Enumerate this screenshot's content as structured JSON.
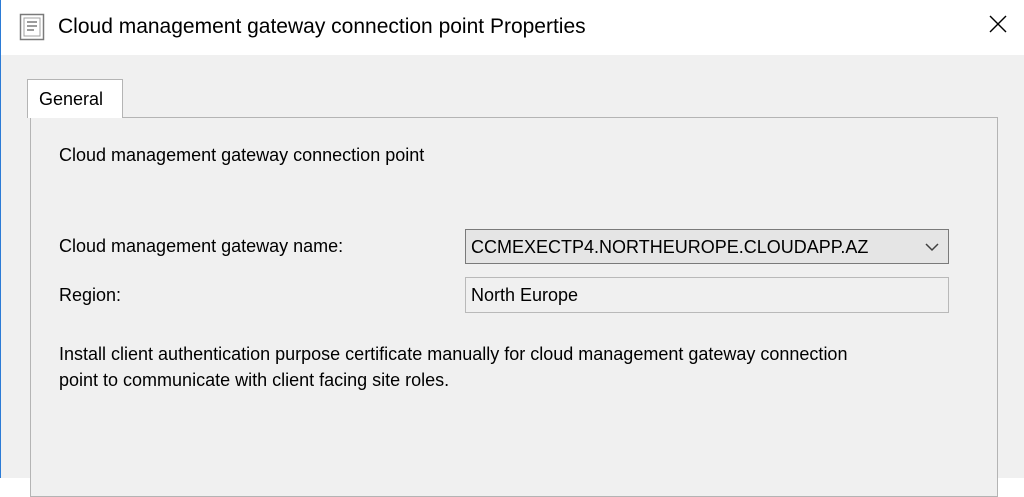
{
  "window": {
    "title": "Cloud management gateway connection point Properties",
    "title_icon": "properties-sheet-icon",
    "close_icon": "close-icon"
  },
  "tabs": [
    {
      "label": "General",
      "selected": true
    }
  ],
  "general": {
    "heading": "Cloud management gateway connection point",
    "gateway_name": {
      "label": "Cloud management gateway name:",
      "value": "CCMEXECTP4.NORTHEUROPE.CLOUDAPP.AZ",
      "icon": "chevron-down-icon"
    },
    "region": {
      "label": "Region:",
      "value": "North Europe"
    },
    "note_line1": "Install client authentication purpose certificate manually for cloud management gateway connection",
    "note_line2": "point to communicate with client facing site roles."
  },
  "colors": {
    "window_border": "#2b7bd6",
    "titlebar": "#ffffff",
    "dialog_background": "#f0f0f0"
  }
}
